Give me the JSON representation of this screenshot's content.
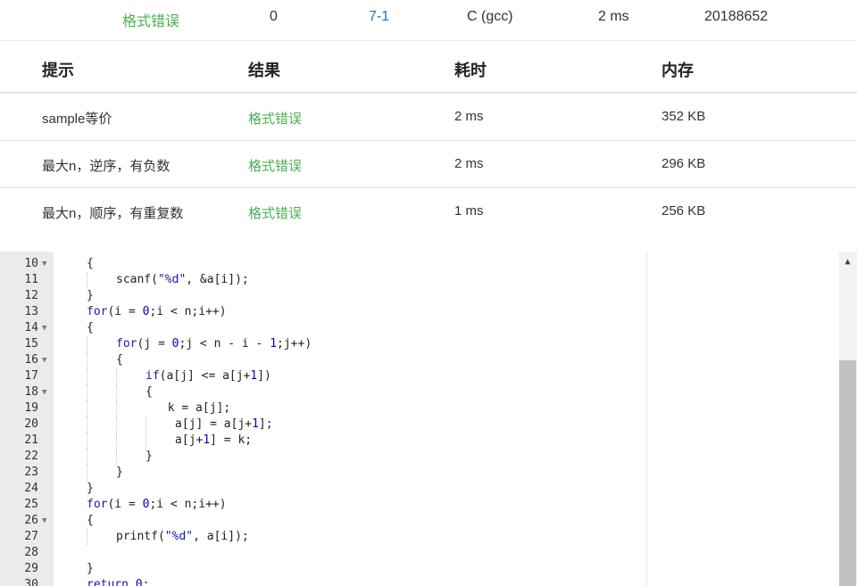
{
  "summary": {
    "status": "格式错误",
    "score": "0",
    "problem": "7-1",
    "compiler": "C (gcc)",
    "time": "2 ms",
    "user": "20188652"
  },
  "table": {
    "headers": [
      "提示",
      "结果",
      "耗时",
      "内存"
    ],
    "rows": [
      {
        "hint": "sample等价",
        "result": "格式错误",
        "time": "2 ms",
        "memory": "352 KB"
      },
      {
        "hint": "最大n，逆序，有负数",
        "result": "格式错误",
        "time": "2 ms",
        "memory": "296 KB"
      },
      {
        "hint": "最大n，顺序，有重复数",
        "result": "格式错误",
        "time": "1 ms",
        "memory": "256 KB"
      }
    ]
  },
  "colors": {
    "status_green": "#4caf50",
    "link_blue": "#2a6fb0",
    "keyword": "#1a1aa6"
  },
  "editor": {
    "lines": [
      {
        "n": "10",
        "fold": true,
        "indent": 1,
        "html": "{"
      },
      {
        "n": "11",
        "fold": false,
        "indent": 2,
        "html": "scanf(<span class=\"str\">\"%d\"</span>, &amp;a[i]);"
      },
      {
        "n": "12",
        "fold": false,
        "indent": 1,
        "html": "}"
      },
      {
        "n": "13",
        "fold": false,
        "indent": 1,
        "html": "<span class=\"kw\">for</span>(i = <span class=\"num\">0</span>;i &lt; n;i++)"
      },
      {
        "n": "14",
        "fold": true,
        "indent": 1,
        "html": "{"
      },
      {
        "n": "15",
        "fold": false,
        "indent": 2,
        "html": "<span class=\"kw\">for</span>(j = <span class=\"num\">0</span>;j &lt; n - i - <span class=\"num\">1</span>;j++)"
      },
      {
        "n": "16",
        "fold": true,
        "indent": 2,
        "html": "{"
      },
      {
        "n": "17",
        "fold": false,
        "indent": 3,
        "html": "<span class=\"kw\">if</span>(a[j] &lt;= a[j+<span class=\"num\">1</span>])"
      },
      {
        "n": "18",
        "fold": true,
        "indent": 3,
        "html": "{"
      },
      {
        "n": "19",
        "fold": false,
        "indent": 3.75,
        "html": "k = a[j];"
      },
      {
        "n": "20",
        "fold": false,
        "indent": 4,
        "html": "a[j] = a[j+<span class=\"num\">1</span>];"
      },
      {
        "n": "21",
        "fold": false,
        "indent": 4,
        "html": "a[j+<span class=\"num\">1</span>] = k;"
      },
      {
        "n": "22",
        "fold": false,
        "indent": 3,
        "html": "}"
      },
      {
        "n": "23",
        "fold": false,
        "indent": 2,
        "html": "}"
      },
      {
        "n": "24",
        "fold": false,
        "indent": 1,
        "html": "}"
      },
      {
        "n": "25",
        "fold": false,
        "indent": 1,
        "html": "<span class=\"kw\">for</span>(i = <span class=\"num\">0</span>;i &lt; n;i++)"
      },
      {
        "n": "26",
        "fold": true,
        "indent": 1,
        "html": "{"
      },
      {
        "n": "27",
        "fold": false,
        "indent": 2,
        "html": "printf(<span class=\"str\">\"%d\"</span>, a[i]);"
      },
      {
        "n": "28",
        "fold": false,
        "indent": 1,
        "html": ""
      },
      {
        "n": "29",
        "fold": false,
        "indent": 1,
        "html": "}"
      },
      {
        "n": "30",
        "fold": false,
        "indent": 1,
        "html": "<span class=\"kw\">return</span> <span class=\"num\">0</span>;"
      }
    ]
  }
}
